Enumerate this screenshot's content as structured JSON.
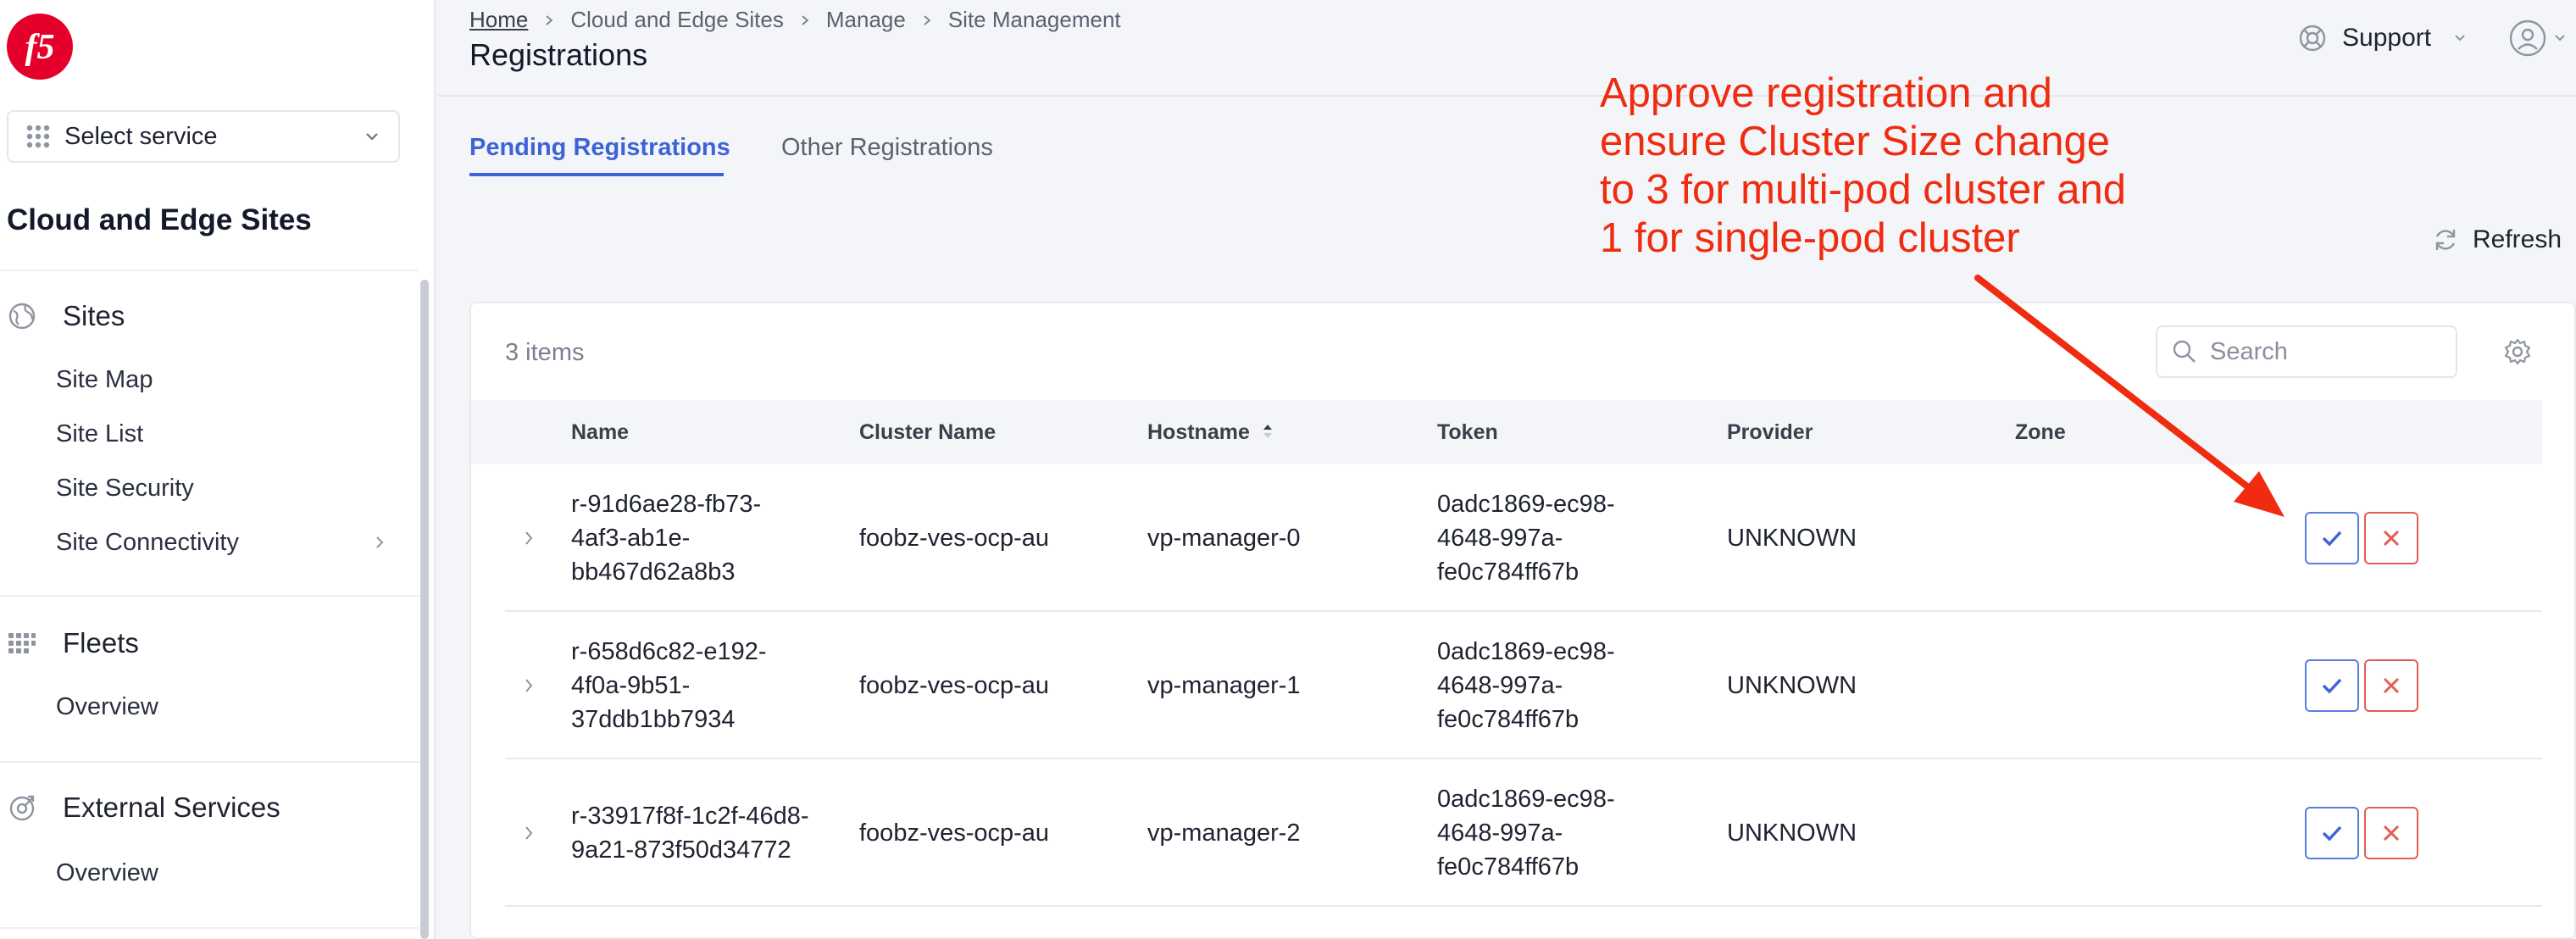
{
  "brand": {
    "logo_text": "f5",
    "accent_color": "#3d63d6",
    "logo_color": "#e4002b"
  },
  "sidebar": {
    "service_select": {
      "label": "Select service"
    },
    "title": "Cloud and Edge Sites",
    "sections": [
      {
        "label": "Sites",
        "icon": "globe-icon",
        "items": [
          {
            "label": "Site Map"
          },
          {
            "label": "Site List"
          },
          {
            "label": "Site Security"
          },
          {
            "label": "Site Connectivity",
            "has_submenu": true
          }
        ]
      },
      {
        "label": "Fleets",
        "icon": "fleet-icon",
        "items": [
          {
            "label": "Overview"
          }
        ]
      },
      {
        "label": "External Services",
        "icon": "external-services-icon",
        "items": [
          {
            "label": "Overview"
          }
        ]
      }
    ]
  },
  "header": {
    "breadcrumb": [
      "Home",
      "Cloud and Edge Sites",
      "Manage",
      "Site Management"
    ],
    "title": "Registrations",
    "support_label": "Support"
  },
  "tabs": [
    {
      "label": "Pending Registrations",
      "active": true
    },
    {
      "label": "Other Registrations",
      "active": false
    }
  ],
  "toolbar": {
    "refresh_label": "Refresh",
    "items_count": "3 items",
    "search_placeholder": "Search"
  },
  "table": {
    "columns": [
      "Name",
      "Cluster Name",
      "Hostname",
      "Token",
      "Provider",
      "Zone"
    ],
    "sorted_column": "Hostname",
    "sort_direction": "ascending",
    "rows": [
      {
        "name": [
          "r-91d6ae28-fb73-",
          "4af3-ab1e-",
          "bb467d62a8b3"
        ],
        "cluster_name": "foobz-ves-ocp-au",
        "hostname": "vp-manager-0",
        "token": [
          "0adc1869-ec98-",
          "4648-997a-",
          "fe0c784ff67b"
        ],
        "provider": "UNKNOWN",
        "zone": ""
      },
      {
        "name": [
          "r-658d6c82-e192-",
          "4f0a-9b51-",
          "37ddb1bb7934"
        ],
        "cluster_name": "foobz-ves-ocp-au",
        "hostname": "vp-manager-1",
        "token": [
          "0adc1869-ec98-",
          "4648-997a-",
          "fe0c784ff67b"
        ],
        "provider": "UNKNOWN",
        "zone": ""
      },
      {
        "name": [
          "r-33917f8f-1c2f-46d8-",
          "9a21-873f50d34772"
        ],
        "cluster_name": "foobz-ves-ocp-au",
        "hostname": "vp-manager-2",
        "token": [
          "0adc1869-ec98-",
          "4648-997a-",
          "fe0c784ff67b"
        ],
        "provider": "UNKNOWN",
        "zone": ""
      }
    ]
  },
  "annotation": {
    "lines": [
      "Approve registration and",
      "ensure Cluster Size change",
      "to 3 for multi-pod cluster and",
      "1 for single-pod cluster"
    ],
    "color": "#f02b0f"
  }
}
